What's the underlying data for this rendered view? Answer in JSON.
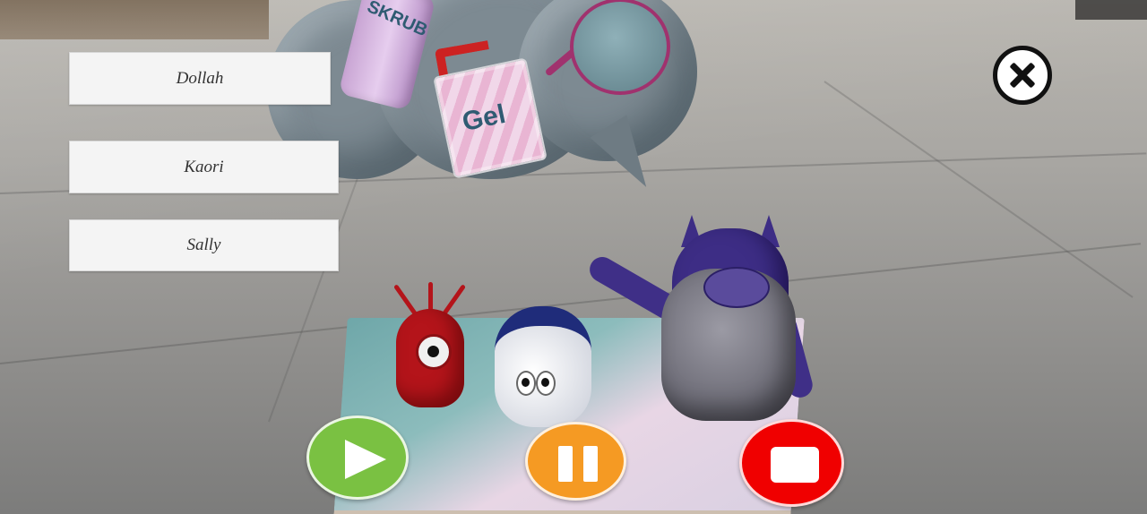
{
  "character_buttons": [
    {
      "label": "Dollah"
    },
    {
      "label": "Kaori"
    },
    {
      "label": "Sally"
    }
  ],
  "scene_labels": {
    "scrub_bottle": "SKRUB",
    "gel_bottle": "Gel"
  },
  "controls": {
    "close_icon": "close-circle-icon",
    "play_icon": "play-icon",
    "pause_icon": "pause-icon",
    "stop_icon": "stop-icon"
  },
  "colors": {
    "play": "#7ac142",
    "pause": "#f59a23",
    "stop": "#f00000",
    "name_button_bg": "#f4f4f4"
  }
}
